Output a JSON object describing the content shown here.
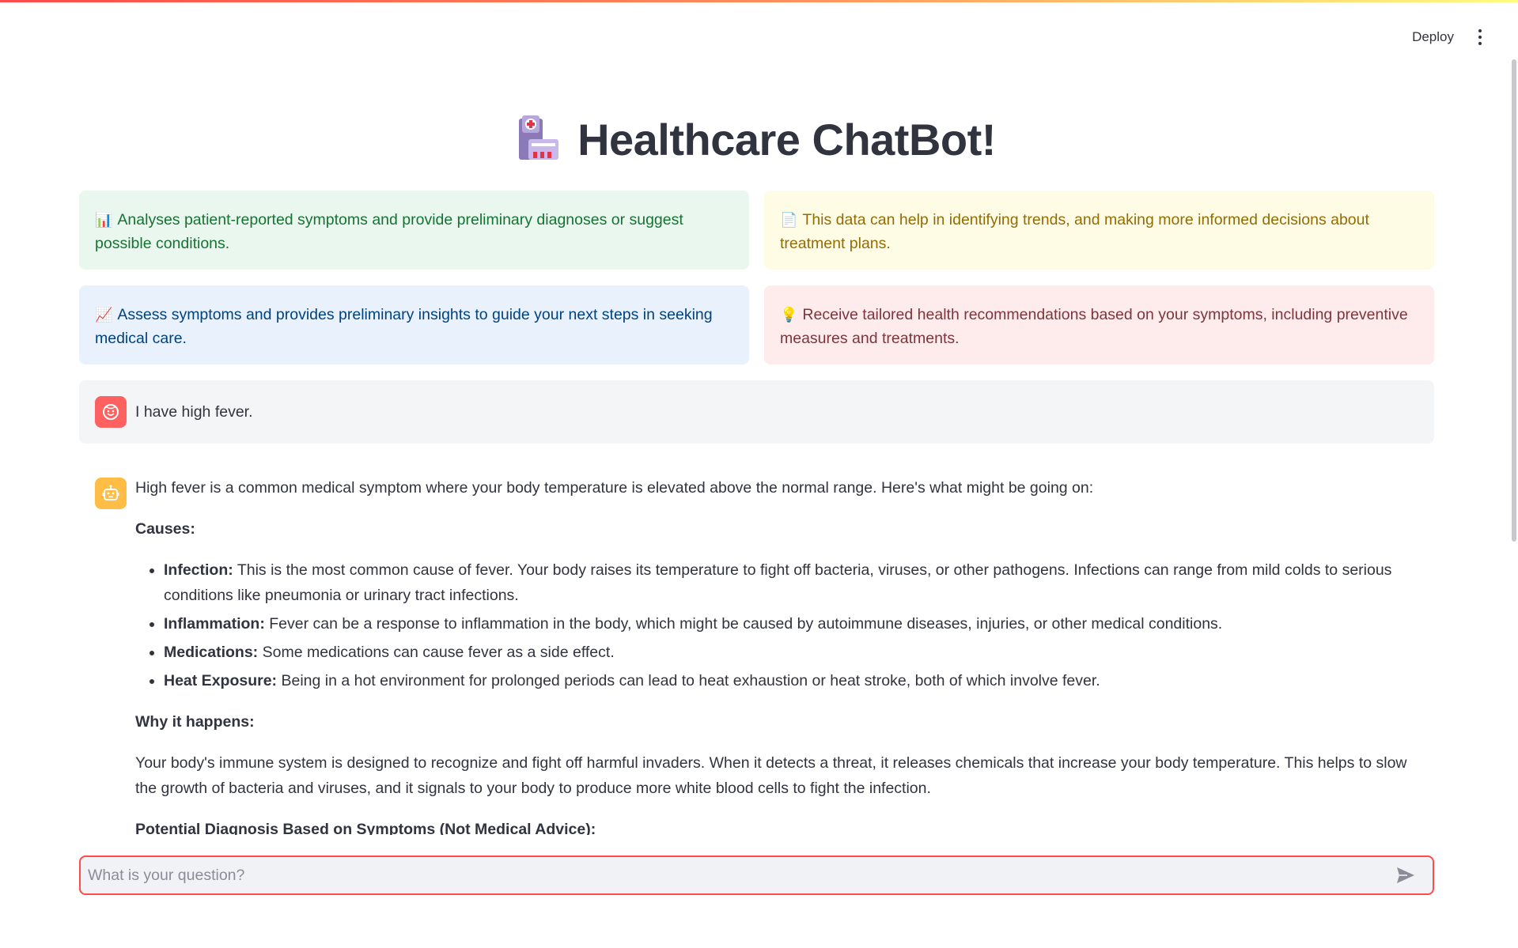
{
  "header": {
    "deploy_label": "Deploy"
  },
  "title": "Healthcare ChatBot!",
  "cards": [
    {
      "emoji": "📊",
      "text": "Analyses patient-reported symptoms and provide preliminary diagnoses or suggest possible conditions."
    },
    {
      "emoji": "📄",
      "text": "This data can help in identifying trends, and making more informed decisions about treatment plans."
    },
    {
      "emoji": "📈",
      "text": "Assess symptoms and provides preliminary insights to guide your next steps in seeking medical care."
    },
    {
      "emoji": "💡",
      "text": "Receive tailored health recommendations based on your symptoms, including preventive measures and treatments."
    }
  ],
  "chat": {
    "user_message": "I have high fever.",
    "bot": {
      "intro": "High fever is a common medical symptom where your body temperature is elevated above the normal range. Here's what might be going on:",
      "causes_heading": "Causes:",
      "causes": [
        {
          "term": "Infection:",
          "text": " This is the most common cause of fever. Your body raises its temperature to fight off bacteria, viruses, or other pathogens. Infections can range from mild colds to serious conditions like pneumonia or urinary tract infections."
        },
        {
          "term": "Inflammation:",
          "text": " Fever can be a response to inflammation in the body, which might be caused by autoimmune diseases, injuries, or other medical conditions."
        },
        {
          "term": "Medications:",
          "text": " Some medications can cause fever as a side effect."
        },
        {
          "term": "Heat Exposure:",
          "text": " Being in a hot environment for prolonged periods can lead to heat exhaustion or heat stroke, both of which involve fever."
        }
      ],
      "why_heading": "Why it happens:",
      "why_text": "Your body's immune system is designed to recognize and fight off harmful invaders. When it detects a threat, it releases chemicals that increase your body temperature. This helps to slow the growth of bacteria and viruses, and it signals to your body to produce more white blood cells to fight the infection.",
      "diagnosis_heading": "Potential Diagnosis Based on Symptoms (Not Medical Advice):"
    }
  },
  "input": {
    "placeholder": "What is your question?",
    "value": ""
  },
  "colors": {
    "accent": "#ff4b4b",
    "user_avatar": "#ff6060",
    "bot_avatar": "#ffbd45"
  }
}
